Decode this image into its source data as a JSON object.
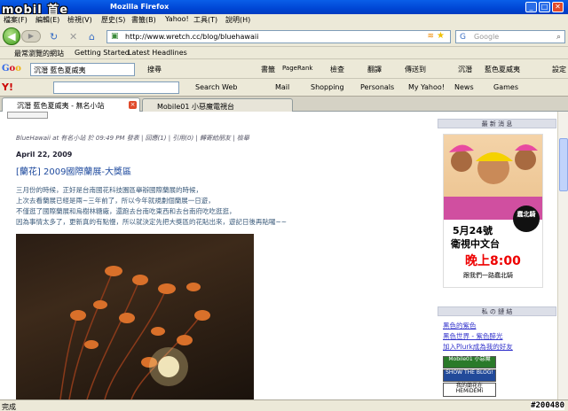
{
  "watermark": "mobil 首e",
  "window": {
    "title": "Mozilla Firefox"
  },
  "menu": [
    "檔案(F)",
    "編輯(E)",
    "檢視(V)",
    "歷史(S)",
    "書籤(B)",
    "Yahoo!",
    "工具(T)",
    "說明(H)"
  ],
  "address": {
    "url": "http://www.wretch.cc/blog/bluehawaii"
  },
  "search": {
    "placeholder": "Google"
  },
  "bookmarks": [
    "最常瀏覽的網站",
    "Getting Started",
    "Latest Headlines"
  ],
  "google_toolbar": {
    "query": "沉潛 藍色夏威夷",
    "labels": [
      "搜尋",
      "書籤",
      "PageRank",
      "檢查",
      "翻譯",
      "傳送到",
      "沉潛",
      "藍色夏威夷",
      "設定"
    ]
  },
  "yahoo_toolbar": {
    "search_web": "Search Web",
    "items": [
      "Mail",
      "Shopping",
      "Personals",
      "My Yahoo!",
      "News",
      "Games"
    ]
  },
  "tabs": [
    {
      "label": "沉潛 藍色夏威夷 - 無名小站",
      "active": true
    },
    {
      "label": "Mobile01 小惡魔電視台",
      "active": false
    }
  ],
  "post": {
    "meta": "BlueHawaii at 有名小站 於 09:49 PM 發表 | 回應(1) | 引用(0) | 轉寄給朋友 | 檢舉",
    "date": "April 22, 2009",
    "title": "[蘭花] 2009國際蘭展-大獎區",
    "paragraphs": [
      "三月份的時候，正好是台南國花科技園區舉辦國際蘭展的時候，",
      "上次去看蘭展已經是兩~三年前了，所以今年就規劃個蘭展一日遊，",
      "不僅逛了國際蘭展和烏樹林糖廠，還跑去台南吃東西和去台南府吃吃逛逛，",
      "因為事情太多了，更新真的有點慢，所以就決定先把大獎區的花貼出來，遊記日後再貼囉~~"
    ]
  },
  "sidebar": {
    "news_header": "最 新 消 息",
    "ad": {
      "line1": "5月24號",
      "line2": "衛視中文台",
      "line3": "晚上8:00",
      "line4": "跟我們一路蠢北騎",
      "badge": "蠢北騎"
    },
    "links_header": "私 の 鏈 結",
    "links": [
      "黑色的紫色",
      "黑色世界 - 紫色醉光",
      "加入Plurk成為我的好友"
    ],
    "badges": [
      "Mobile01 小惡魔",
      "SHOW THE BLOG!",
      "我的蘭花在 HEMiDEMi"
    ]
  },
  "status": {
    "text": "完成",
    "image_id": "#200480"
  },
  "colors": {
    "accent": "#1e4a9e",
    "ad_red": "#ee0000"
  }
}
